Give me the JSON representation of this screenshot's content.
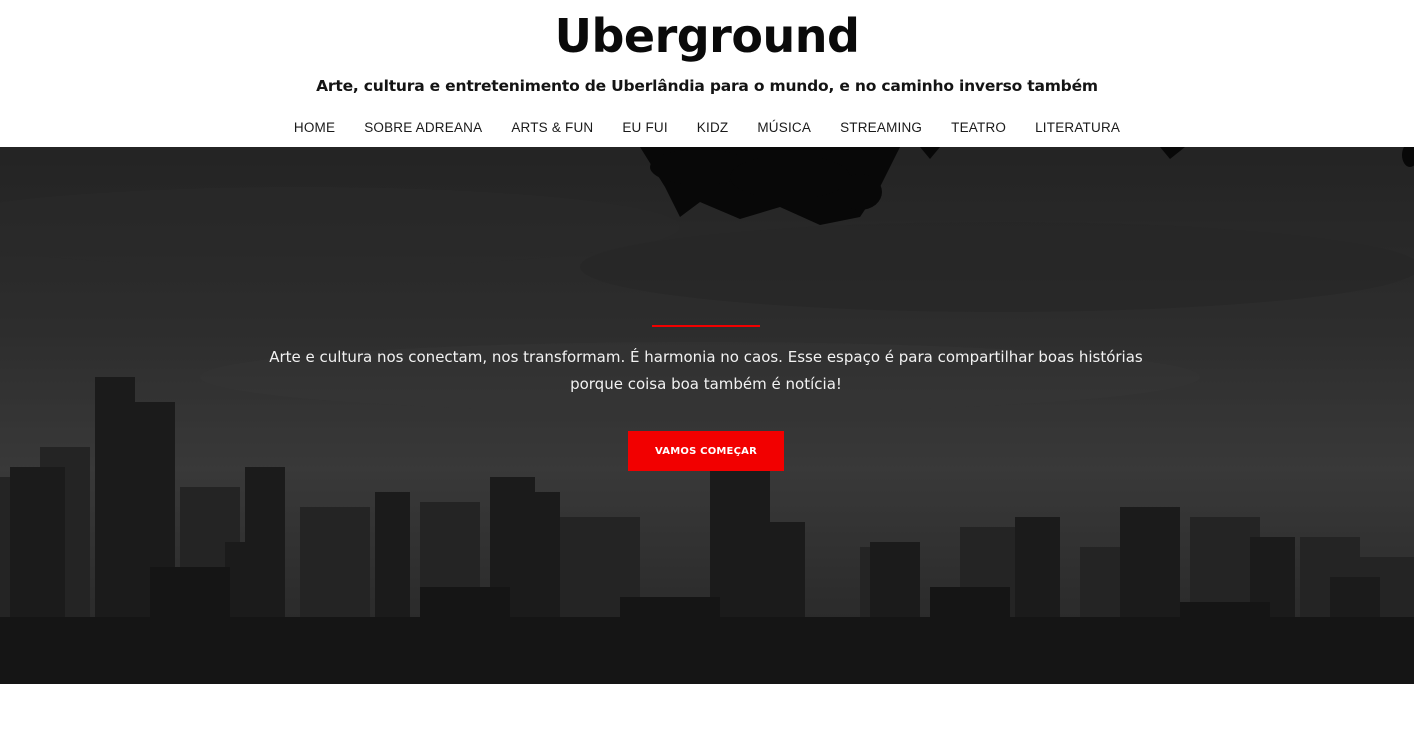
{
  "site": {
    "title": "Uberground",
    "tagline": "Arte, cultura e entretenimento de Uberlândia para o mundo, e no caminho inverso também"
  },
  "nav": {
    "items": [
      {
        "label": "HOME"
      },
      {
        "label": "SOBRE ADREANA"
      },
      {
        "label": "ARTS & FUN"
      },
      {
        "label": "EU FUI"
      },
      {
        "label": "KIDZ"
      },
      {
        "label": "MÚSICA"
      },
      {
        "label": "STREAMING"
      },
      {
        "label": "TEATRO"
      },
      {
        "label": "LITERATURA"
      }
    ]
  },
  "hero": {
    "text": "Arte e cultura nos conectam, nos transformam. É harmonia no caos. Esse espaço é para compartilhar boas histórias porque coisa boa também é notícia!",
    "cta_label": "VAMOS COMEÇAR",
    "background_image": "black-and-white city skyline with tree branches"
  },
  "colors": {
    "accent": "#f20000",
    "hero_text": "#f2f2f2",
    "header_bg": "#ffffff"
  }
}
